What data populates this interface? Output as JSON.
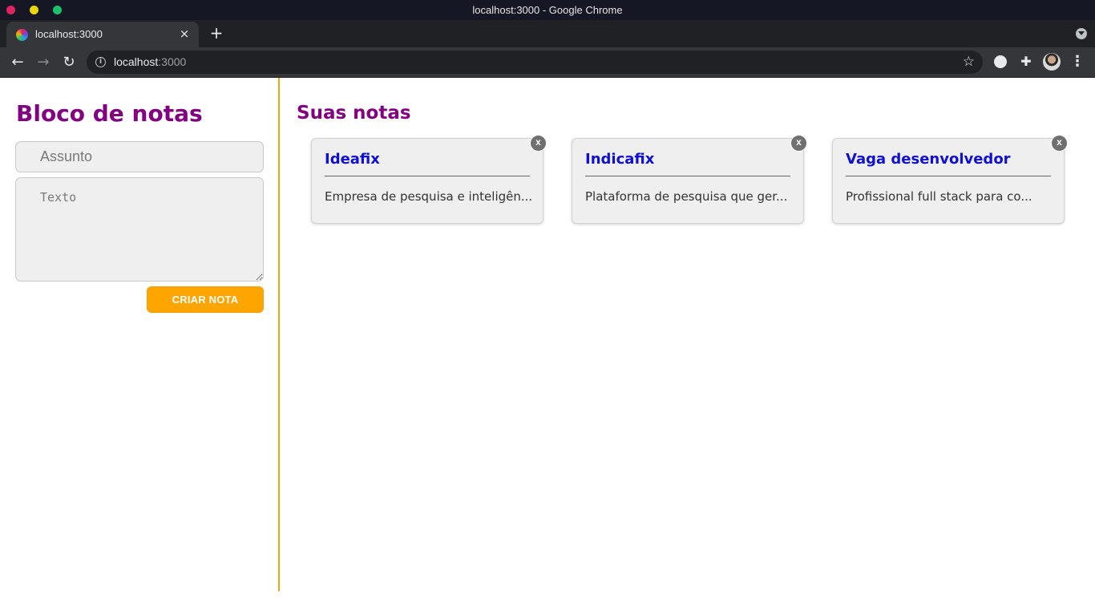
{
  "window": {
    "title": "localhost:3000 - Google Chrome"
  },
  "browser": {
    "tab": {
      "title": "localhost:3000",
      "close": "×"
    },
    "new_tab": "+",
    "nav": {
      "back": "←",
      "forward": "→",
      "reload": "↻"
    },
    "url": {
      "host": "localhost",
      "port": ":3000"
    },
    "icons": [
      "info-icon",
      "star-icon",
      "extension-icon",
      "puzzle-icon",
      "profile-avatar",
      "menu-icon"
    ]
  },
  "app": {
    "title": "Bloco de notas",
    "form": {
      "subject_placeholder": "Assunto",
      "text_placeholder": "Texto",
      "create_button": "CRIAR NOTA"
    },
    "notes_heading": "Suas notas",
    "notes": [
      {
        "title": "Ideafix",
        "text": "Empresa de pesquisa e inteligên...",
        "delete": "x"
      },
      {
        "title": "Indicafix",
        "text": "Plataforma de pesquisa que ger...",
        "delete": "x"
      },
      {
        "title": "Vaga desenvolvedor",
        "text": "Profissional full stack para co...",
        "delete": "x"
      }
    ],
    "colors": {
      "heading": "#800080",
      "note_title": "#1010d0",
      "accent": "#ffa500"
    }
  }
}
